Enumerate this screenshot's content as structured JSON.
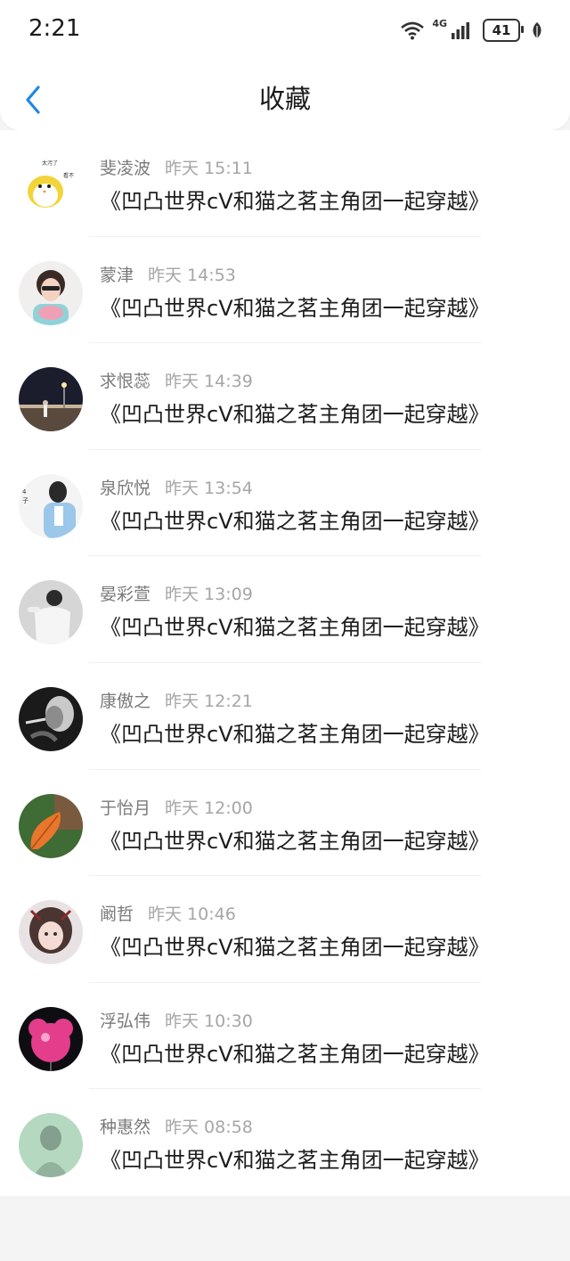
{
  "status_bar": {
    "time": "2:21",
    "network": "4G",
    "battery": "41",
    "icons": [
      "wifi-icon",
      "signal-icon",
      "battery-icon",
      "leaf-icon"
    ]
  },
  "header": {
    "back_icon": "chevron-left-icon",
    "title": "收藏"
  },
  "items": [
    {
      "name": "斐凌波",
      "date": "昨天 15:11",
      "message": "《凹凸世界cV和猫之茗主角团一起穿越》",
      "avatar": "cartoon-bird"
    },
    {
      "name": "蒙津",
      "date": "昨天 14:53",
      "message": "《凹凸世界cV和猫之茗主角团一起穿越》",
      "avatar": "girl-sunglasses"
    },
    {
      "name": "求恨蕊",
      "date": "昨天 14:39",
      "message": "《凹凸世界cV和猫之茗主角团一起穿越》",
      "avatar": "night-street"
    },
    {
      "name": "泉欣悦",
      "date": "昨天 13:54",
      "message": "《凹凸世界cV和猫之茗主角团一起穿越》",
      "avatar": "girl-blue-shirt"
    },
    {
      "name": "晏彩萱",
      "date": "昨天 13:09",
      "message": "《凹凸世界cV和猫之茗主角团一起穿越》",
      "avatar": "monochrome-girl"
    },
    {
      "name": "康傲之",
      "date": "昨天 12:21",
      "message": "《凹凸世界cV和猫之茗主角团一起穿越》",
      "avatar": "dark-portrait"
    },
    {
      "name": "于怡月",
      "date": "昨天 12:00",
      "message": "《凹凸世界cV和猫之茗主角团一起穿越》",
      "avatar": "orange-leaf"
    },
    {
      "name": "阚哲",
      "date": "昨天 10:46",
      "message": "《凹凸世界cV和猫之茗主角团一起穿越》",
      "avatar": "anime-girl"
    },
    {
      "name": "浮弘伟",
      "date": "昨天 10:30",
      "message": "《凹凸世界cV和猫之茗主角团一起穿越》",
      "avatar": "pink-balloon"
    },
    {
      "name": "种惠然",
      "date": "昨天 08:58",
      "message": "《凹凸世界cV和猫之茗主角团一起穿越》",
      "avatar": "green-figure"
    }
  ],
  "colors": {
    "accent": "#1e88e5",
    "page_bg": "#f4f4f4",
    "meta_text": "#8a8a8a"
  }
}
